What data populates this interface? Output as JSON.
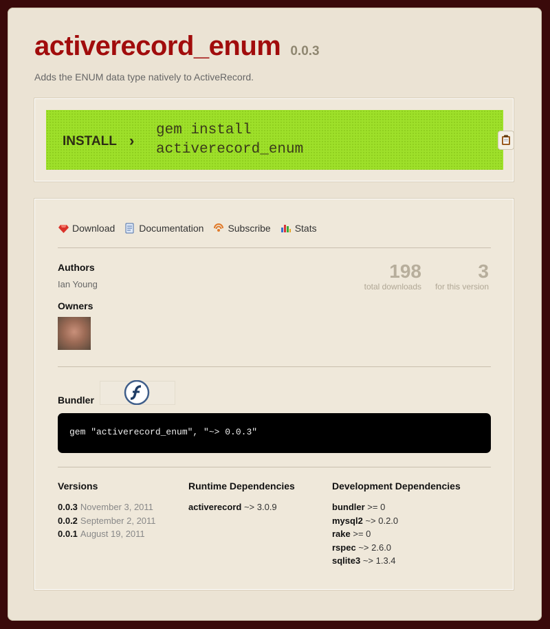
{
  "gem": {
    "name": "activerecord_enum",
    "version": "0.0.3",
    "description": "Adds the ENUM data type natively to ActiveRecord."
  },
  "install": {
    "label": "INSTALL",
    "chevron": "›",
    "command_line1": "gem install",
    "command_line2": "activerecord_enum",
    "copy_icon": "clipboard-icon"
  },
  "links": [
    {
      "label": "Download",
      "icon": "gem-icon"
    },
    {
      "label": "Documentation",
      "icon": "document-icon"
    },
    {
      "label": "Subscribe",
      "icon": "rss-icon"
    },
    {
      "label": "Stats",
      "icon": "bar-chart-icon"
    }
  ],
  "authors": {
    "heading": "Authors",
    "name": "Ian Young"
  },
  "owners": {
    "heading": "Owners",
    "avatar": "avatar-icon"
  },
  "stats": {
    "total_downloads": "198",
    "total_downloads_caption": "total downloads",
    "version_downloads": "3",
    "version_downloads_caption": "for this version"
  },
  "bundler": {
    "heading": "Bundler",
    "code": "gem \"activerecord_enum\", \"~> 0.0.3\"",
    "plugin_icon": "flash-icon"
  },
  "versions": {
    "heading": "Versions",
    "items": [
      {
        "number": "0.0.3",
        "date": "November 3, 2011"
      },
      {
        "number": "0.0.2",
        "date": "September 2, 2011"
      },
      {
        "number": "0.0.1",
        "date": "August 19, 2011"
      }
    ]
  },
  "runtime_dependencies": {
    "heading": "Runtime Dependencies",
    "items": [
      {
        "name": "activerecord",
        "requirement": "~> 3.0.9"
      }
    ]
  },
  "development_dependencies": {
    "heading": "Development Dependencies",
    "items": [
      {
        "name": "bundler",
        "requirement": ">= 0"
      },
      {
        "name": "mysql2",
        "requirement": "~> 0.2.0"
      },
      {
        "name": "rake",
        "requirement": ">= 0"
      },
      {
        "name": "rspec",
        "requirement": "~> 2.6.0"
      },
      {
        "name": "sqlite3",
        "requirement": "~> 1.3.4"
      }
    ]
  },
  "colors": {
    "title": "#a10c0c",
    "install_strip": "#9ee02a",
    "page_background": "#ebe3d4",
    "outer_background": "#3a0a0a"
  }
}
